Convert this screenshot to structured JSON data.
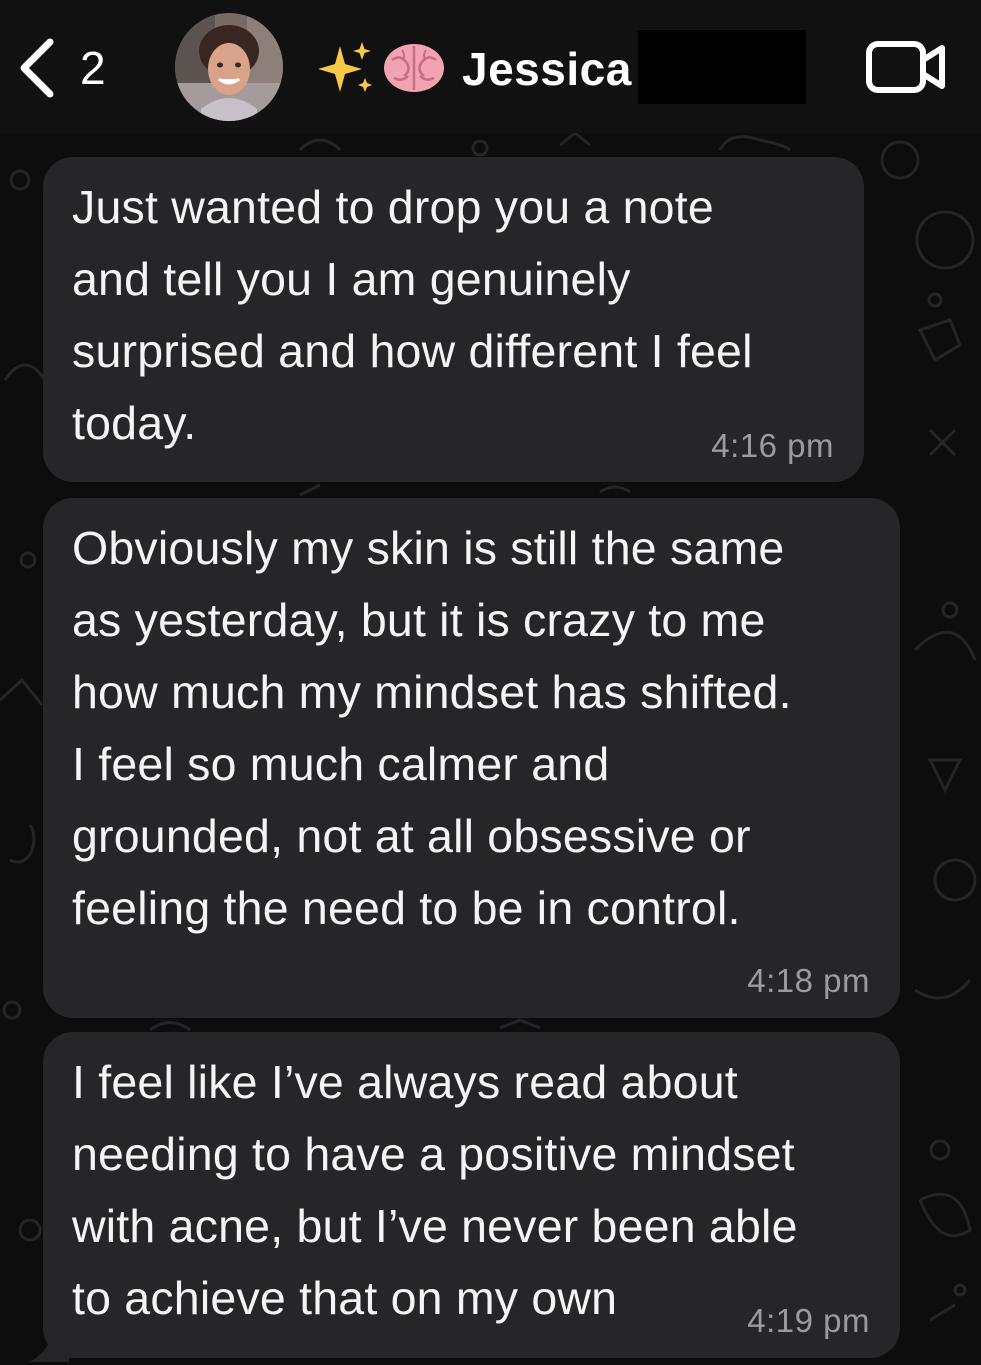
{
  "header": {
    "back_count": "2",
    "contact_emoji_1": "sparkles-icon",
    "contact_emoji_2": "brain-icon",
    "contact_name": "Jessica",
    "video_icon": "video-call-icon"
  },
  "messages": [
    {
      "lines": [
        "Just wanted to drop you a note",
        "and tell you I am genuinely",
        "surprised and how different I feel",
        "today."
      ],
      "time": "4:16 pm"
    },
    {
      "lines": [
        "Obviously my skin is still the same",
        "as yesterday, but it is crazy to me",
        "how much my mindset has shifted.",
        "I feel so much calmer and",
        "grounded, not at all obsessive or",
        "feeling the need to be in control."
      ],
      "time": "4:18 pm"
    },
    {
      "lines": [
        "I feel like I’ve always read about",
        "needing to have a positive mindset",
        "with acne, but I’ve never been able",
        "to achieve that on my own"
      ],
      "time": "4:19 pm"
    }
  ],
  "colors": {
    "background": "#0d0d0e",
    "header": "#111112",
    "bubble": "#262628",
    "timestamp": "#9b9b9f",
    "text": "#f4f4f4"
  }
}
